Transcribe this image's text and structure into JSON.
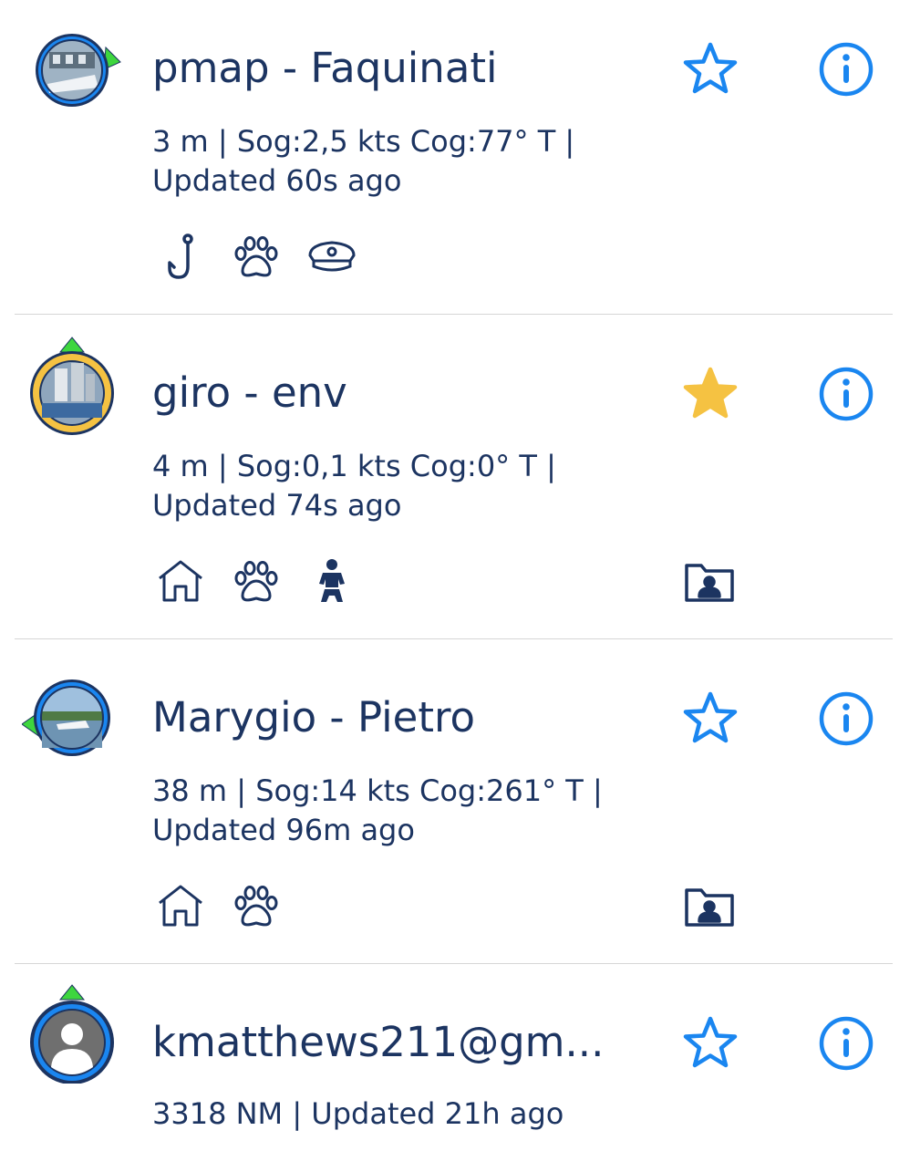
{
  "colors": {
    "text": "#1c3461",
    "accent_blue": "#1a86f0",
    "star_filled": "#f5c242",
    "heading_arrow_green": "#3ed63e",
    "divider": "#d6d6d6"
  },
  "vessels": [
    {
      "name": "pmap - Faquinati",
      "info_line1": "3 m | Sog:2,5 kts Cog:77° T |",
      "info_line2": "Updated 60s ago",
      "favorite": false,
      "tag_icons": [
        "fishing-hook-icon",
        "paw-icon",
        "captain-hat-icon"
      ],
      "has_folder": false,
      "avatar_ring_color": "#1a86f0"
    },
    {
      "name": "giro - env",
      "info_line1": "4 m | Sog:0,1 kts Cog:0° T |",
      "info_line2": "Updated 74s ago",
      "favorite": true,
      "tag_icons": [
        "home-icon",
        "paw-icon",
        "baby-icon"
      ],
      "has_folder": true,
      "avatar_ring_color": "#f5c242"
    },
    {
      "name": "Marygio - Pietro",
      "info_line1": "38 m | Sog:14 kts Cog:261° T |",
      "info_line2": "Updated 96m ago",
      "favorite": false,
      "tag_icons": [
        "home-icon",
        "paw-icon"
      ],
      "has_folder": true,
      "avatar_ring_color": "#1a86f0"
    },
    {
      "name": "kmatthews211@gm...",
      "info_line1": "3318 NM | Updated 21h ago",
      "info_line2": "",
      "favorite": false,
      "tag_icons": [],
      "has_folder": false,
      "avatar_ring_color": "#1a86f0"
    }
  ]
}
